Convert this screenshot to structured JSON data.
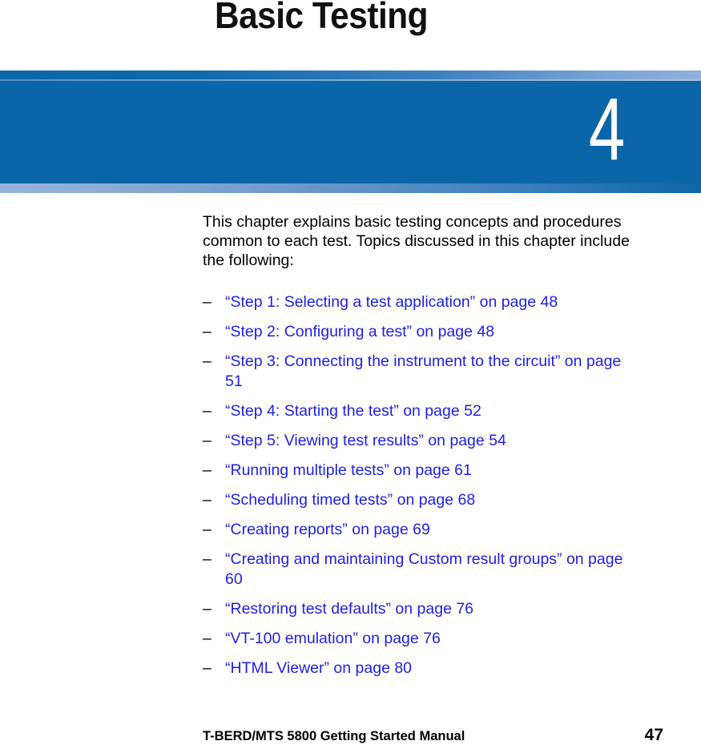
{
  "page": {
    "chapter_title": "Basic Testing",
    "chapter_number": "4",
    "accent_blue": "#0a66a8",
    "accent_light_blue": "#97b3db",
    "link_color": "#1f1fdd"
  },
  "intro": {
    "text": "This chapter explains basic testing concepts and procedures common to each test. Topics discussed in this chapter include the following:"
  },
  "toc": {
    "bullet": "–",
    "items": [
      {
        "label": "“Step 1: Selecting a test application” on page 48"
      },
      {
        "label": "“Step 2: Configuring a test” on page 48"
      },
      {
        "label": "“Step 3: Connecting the instrument to the circuit” on page 51"
      },
      {
        "label": "“Step 4: Starting the test” on page 52"
      },
      {
        "label": "“Step 5: Viewing test results” on page 54"
      },
      {
        "label": "“Running multiple tests” on page 61"
      },
      {
        "label": "“Scheduling timed tests” on page 68"
      },
      {
        "label": "“Creating reports” on page 69"
      },
      {
        "label": "“Creating and maintaining Custom result groups” on page 60"
      },
      {
        "label": "“Restoring test defaults” on page 76"
      },
      {
        "label": "“VT-100 emulation” on page 76"
      },
      {
        "label": "“HTML Viewer” on page 80"
      }
    ]
  },
  "footer": {
    "manual_title": "T-BERD/MTS 5800 Getting Started Manual",
    "page_number": "47"
  }
}
